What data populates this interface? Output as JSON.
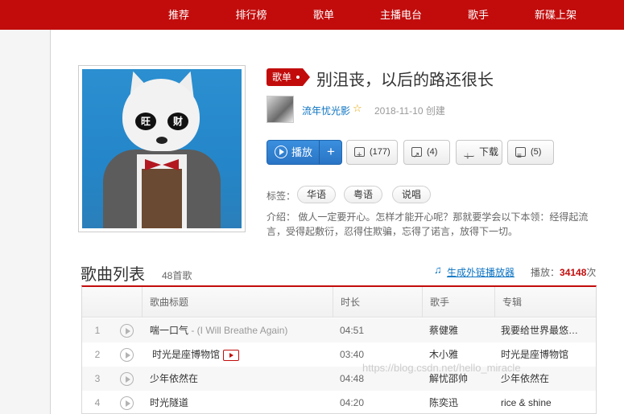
{
  "nav": {
    "items": [
      "推荐",
      "排行榜",
      "歌单",
      "主播电台",
      "歌手",
      "新碟上架"
    ]
  },
  "cover": {
    "glasses_left": "旺",
    "glasses_right": "财"
  },
  "playlist": {
    "badge": "歌单",
    "title": "别沮丧，以后的路还很长",
    "creator": "流年忧光影",
    "created": "2018-11-10 创建",
    "buttons": {
      "play": "播放",
      "plus": "+",
      "favorite": "(177)",
      "share": "(4)",
      "download": "下载",
      "comment": "(5)"
    },
    "tags_label": "标签：",
    "tags": [
      "华语",
      "粤语",
      "说唱"
    ],
    "intro": "介绍：  做人一定要开心。怎样才能开心呢？那就要学会以下本领：经得起流言，受得起敷衍，忍得住欺骗，忘得了诺言，放得下一切。"
  },
  "song_list": {
    "title": "歌曲列表",
    "count": "48首歌",
    "ext_link": "生成外链播放器",
    "play_label": "播放：",
    "play_count": "34148",
    "play_suffix": "次",
    "headers": [
      "歌曲标题",
      "时长",
      "歌手",
      "专辑"
    ],
    "rows": [
      {
        "idx": "1",
        "title": "喘一口气",
        "sub": " - (I Will Breathe Again)",
        "duration": "04:51",
        "artist": "蔡健雅",
        "album": "我要给世界最悠…"
      },
      {
        "idx": "2",
        "title": "时光是座博物馆",
        "sub": "",
        "duration": "03:40",
        "artist": "木小雅",
        "album": "时光是座博物馆"
      },
      {
        "idx": "3",
        "title": "少年依然在",
        "sub": "",
        "duration": "04:48",
        "artist": "解忧邵帅",
        "album": "少年依然在"
      },
      {
        "idx": "4",
        "title": "时光隧道",
        "sub": "",
        "duration": "04:20",
        "artist": "陈奕迅",
        "album": "rice & shine"
      }
    ]
  },
  "watermark": "https://blog.csdn.net/hello_miracle"
}
